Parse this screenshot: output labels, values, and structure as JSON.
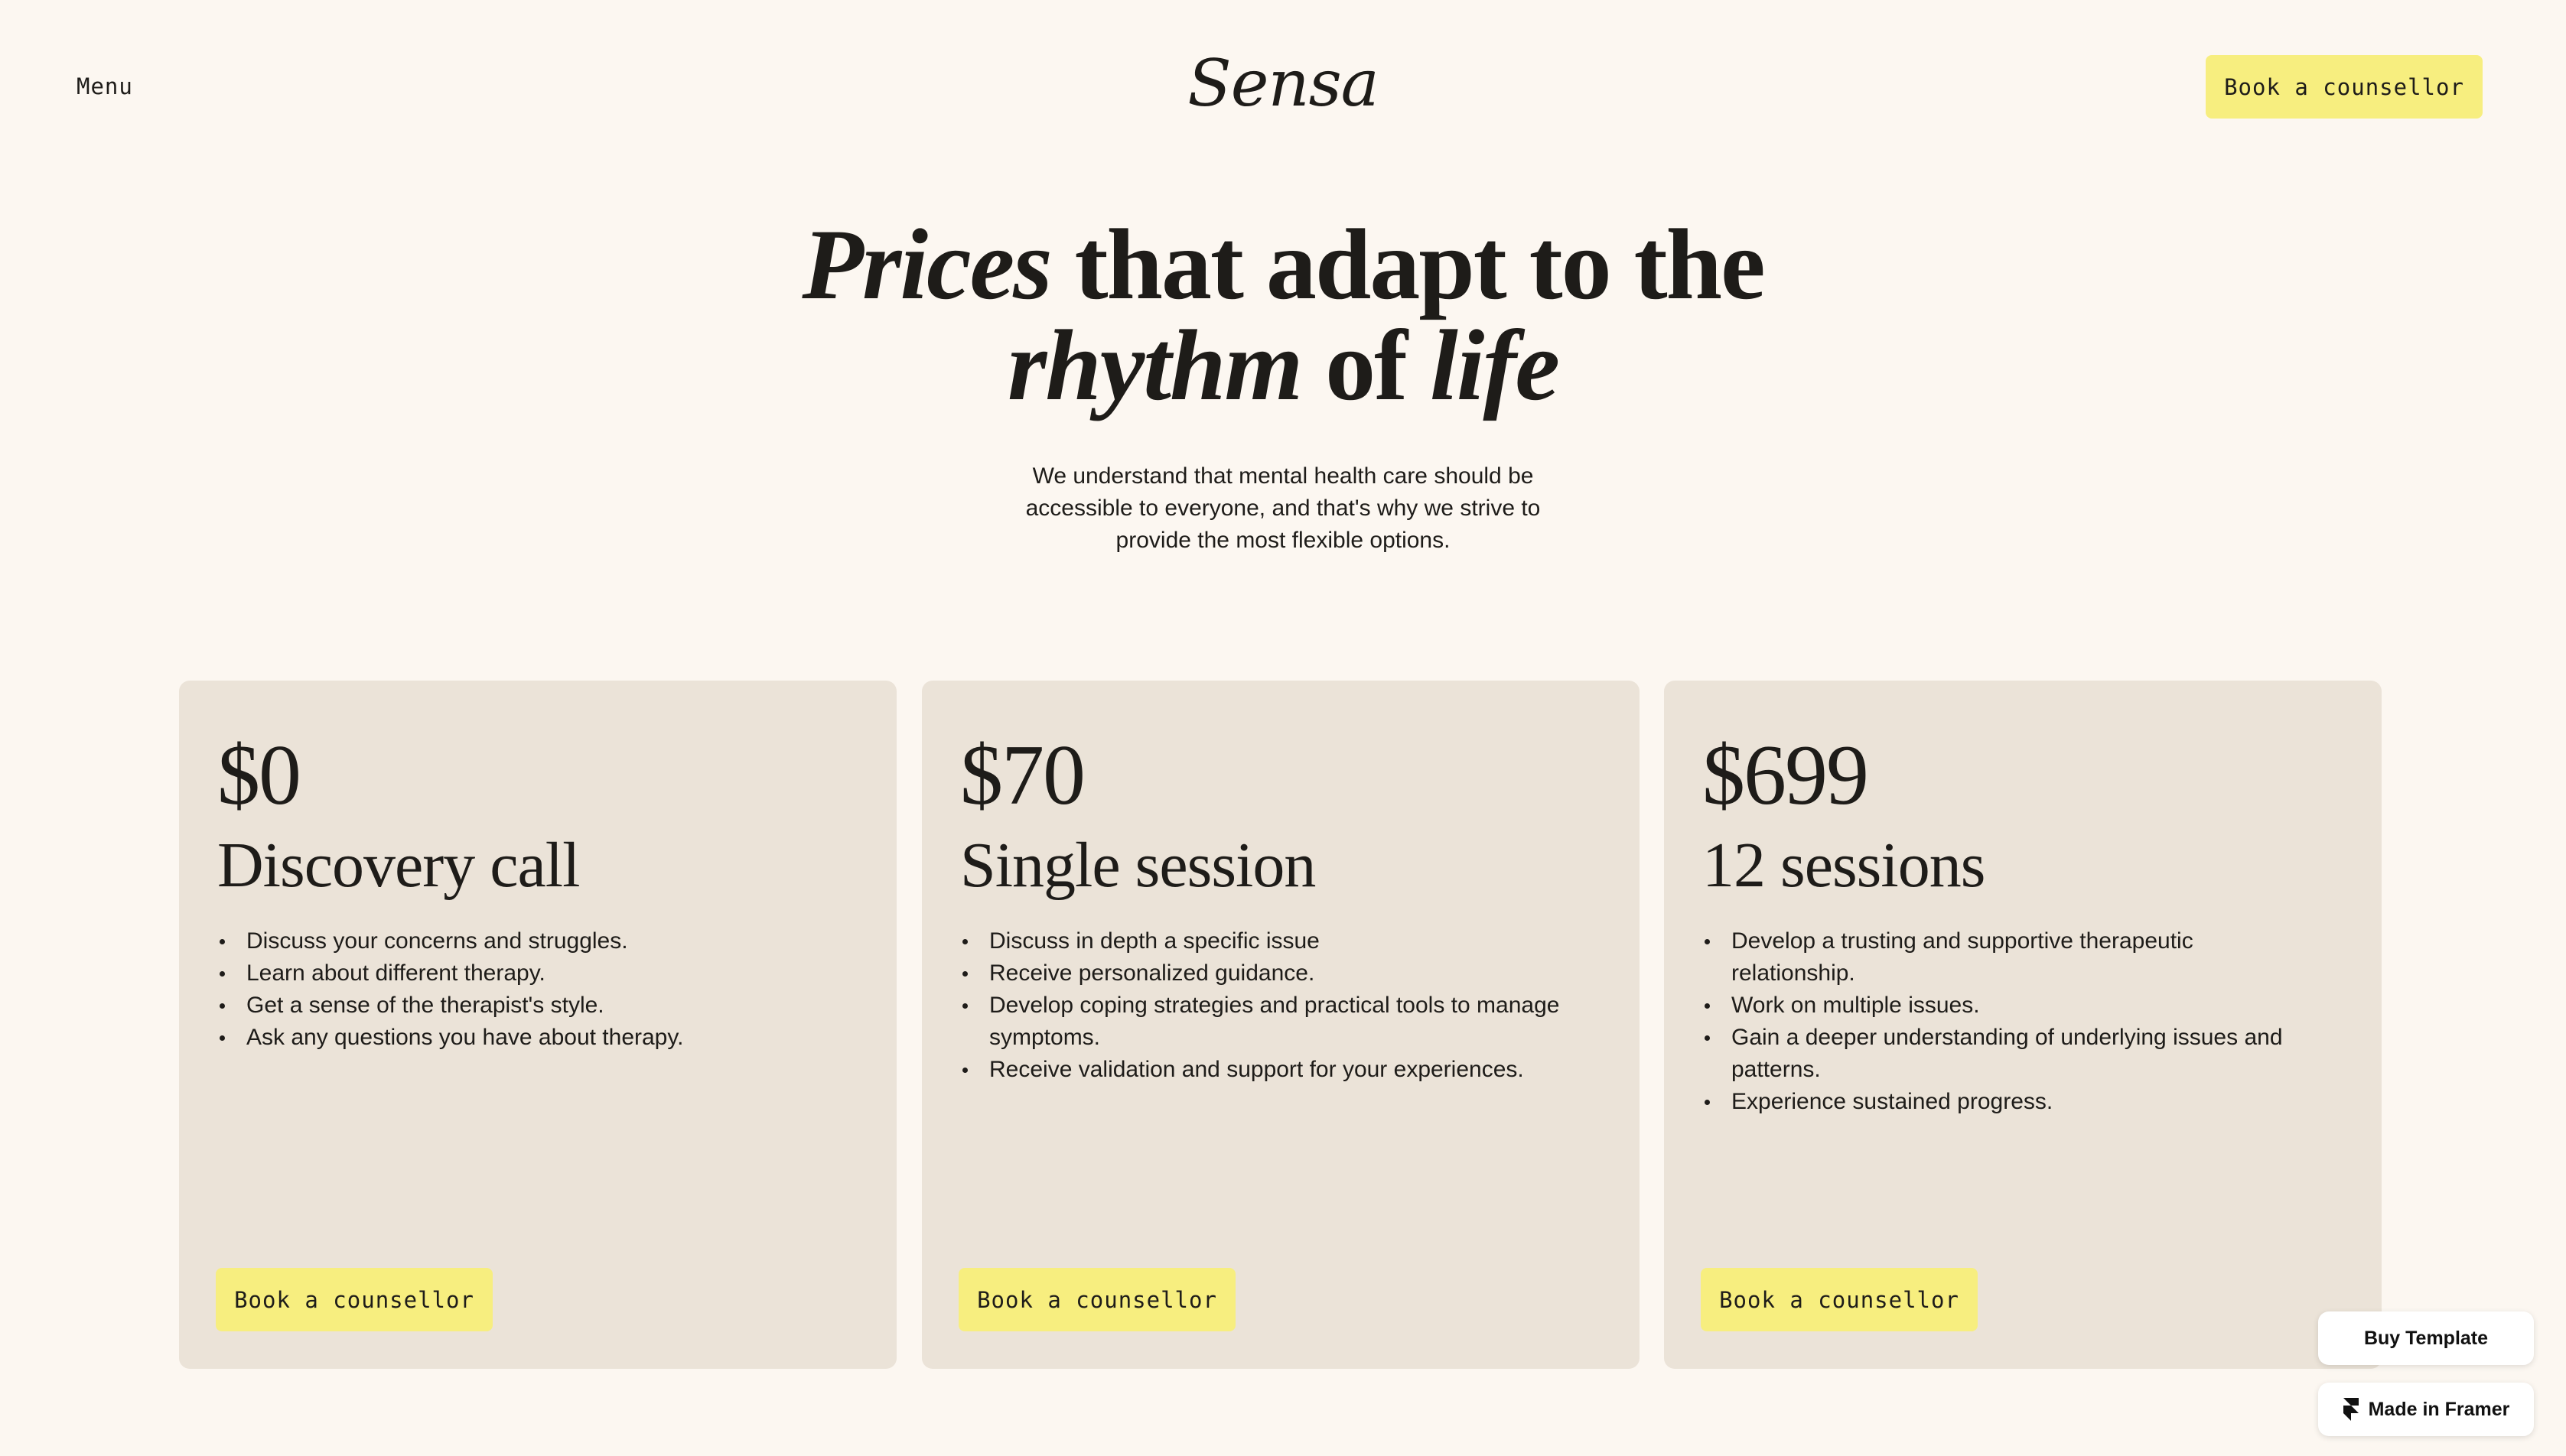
{
  "header": {
    "menu_label": "Menu",
    "logo_text": "Sensa",
    "cta_label": "Book a counsellor"
  },
  "hero": {
    "title_italic_1": "Prices",
    "title_regular_1": " that adapt to the",
    "title_italic_2": "rhythm",
    "title_regular_2": " of ",
    "title_italic_3": "life",
    "subtitle": "We understand that mental health care should be accessible to everyone, and that's why we strive to provide the most flexible options."
  },
  "plans": [
    {
      "price": "$0",
      "name": "Discovery call",
      "features": [
        "Discuss your concerns and struggles.",
        "Learn about different therapy.",
        "Get a sense of the therapist's style.",
        "Ask any questions you have about therapy."
      ],
      "cta_label": "Book a counsellor"
    },
    {
      "price": "$70",
      "name": "Single session",
      "features": [
        "Discuss in depth a specific issue",
        "Receive personalized guidance.",
        "Develop coping strategies and practical tools to manage symptoms.",
        "Receive validation and support for your experiences."
      ],
      "cta_label": "Book a counsellor"
    },
    {
      "price": "$699",
      "name": "12 sessions",
      "features": [
        "Develop a trusting and supportive therapeutic relationship.",
        "Work on multiple issues.",
        "Gain a deeper understanding of underlying issues and patterns.",
        "Experience sustained progress."
      ],
      "cta_label": "Book a counsellor"
    }
  ],
  "badges": {
    "buy_template": "Buy Template",
    "made_in_framer": "Made in Framer",
    "framer_icon": "framer-logo-icon"
  },
  "colors": {
    "background": "#fcf7f1",
    "card": "#ebe3d8",
    "accent_button": "#f7ee7f",
    "text": "#1e1c19"
  }
}
